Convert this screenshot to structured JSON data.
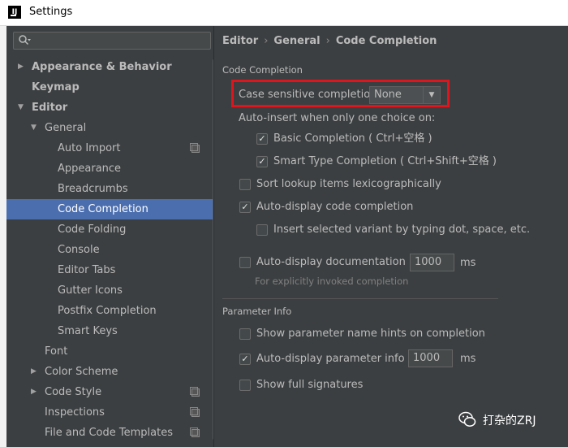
{
  "window": {
    "title": "Settings",
    "app_icon_text": "IJ"
  },
  "search": {
    "placeholder": "",
    "value": ""
  },
  "breadcrumb": [
    "Editor",
    "General",
    "Code Completion"
  ],
  "tree": [
    {
      "label": "Appearance & Behavior",
      "bold": true,
      "arrow": "right"
    },
    {
      "label": "Keymap",
      "bold": true
    },
    {
      "label": "Editor",
      "bold": true,
      "arrow": "down"
    },
    {
      "label": "General",
      "arrow": "down"
    },
    {
      "label": "Auto Import",
      "copy_icon": true
    },
    {
      "label": "Appearance"
    },
    {
      "label": "Breadcrumbs"
    },
    {
      "label": "Code Completion",
      "selected": true
    },
    {
      "label": "Code Folding"
    },
    {
      "label": "Console"
    },
    {
      "label": "Editor Tabs"
    },
    {
      "label": "Gutter Icons"
    },
    {
      "label": "Postfix Completion"
    },
    {
      "label": "Smart Keys"
    },
    {
      "label": "Font"
    },
    {
      "label": "Color Scheme",
      "arrow": "right"
    },
    {
      "label": "Code Style",
      "arrow": "right",
      "copy_icon": true
    },
    {
      "label": "Inspections",
      "copy_icon": true
    },
    {
      "label": "File and Code Templates",
      "copy_icon": true
    }
  ],
  "code_completion": {
    "section_title": "Code Completion",
    "case_sensitive_label": "Case sensitive completion:",
    "case_sensitive_value": "None",
    "auto_insert_label": "Auto-insert when only one choice on:",
    "basic_completion": {
      "label": "Basic Completion ( Ctrl+空格 )",
      "checked": true
    },
    "smart_type_completion": {
      "label": "Smart Type Completion ( Ctrl+Shift+空格 )",
      "checked": true
    },
    "sort_lexicographically": {
      "label": "Sort lookup items lexicographically",
      "checked": false
    },
    "auto_display_completion": {
      "label": "Auto-display code completion",
      "checked": true
    },
    "insert_selected_variant": {
      "label": "Insert selected variant by typing dot, space, etc.",
      "checked": false
    },
    "auto_display_documentation": {
      "label": "Auto-display documentation in",
      "checked": false,
      "value": "1000",
      "unit": "ms"
    },
    "explicit_hint": "For explicitly invoked completion"
  },
  "parameter_info": {
    "section_title": "Parameter Info",
    "show_name_hints": {
      "label": "Show parameter name hints on completion",
      "checked": false
    },
    "auto_display_param_info": {
      "label": "Auto-display parameter info in",
      "checked": true,
      "value": "1000",
      "unit": "ms"
    },
    "show_full_signatures": {
      "label": "Show full signatures",
      "checked": false
    }
  },
  "watermark": {
    "text": "打杂的ZRJ"
  },
  "colors": {
    "selection": "#4b6eaf",
    "highlight_box": "#e0141d",
    "background": "#3c3f41"
  }
}
